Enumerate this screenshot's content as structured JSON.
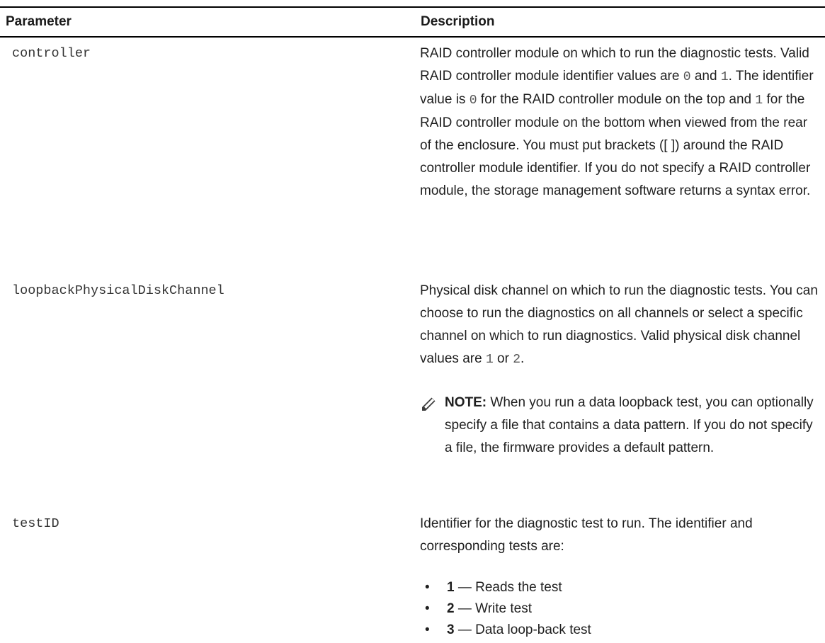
{
  "table": {
    "headers": {
      "parameter": "Parameter",
      "description": "Description"
    },
    "rows": [
      {
        "parameter": "controller",
        "description": {
          "p1": "RAID controller module on which to run the diagnostic tests. Valid RAID controller module identifier values are ",
          "c1": "0",
          "p2": " and ",
          "c2": "1",
          "p3": ". The identifier value is ",
          "c3": "0",
          "p4": " for the RAID controller module on the top and ",
          "c4": "1",
          "p5": " for the RAID controller module on the bottom when viewed from the rear of the enclosure. You must put brackets ([ ]) around the RAID controller module identifier. If you do not specify a RAID controller module, the storage management software returns a syntax error."
        }
      },
      {
        "parameter": "loopbackPhysicalDiskChannel",
        "description": {
          "p1": "Physical disk channel on which to run the diagnostic tests. You can choose to run the diagnostics on all channels or select a specific channel on which to run diagnostics. Valid physical disk channel values are ",
          "c1": "1",
          "p2": " or ",
          "c2": "2",
          "p3": "."
        },
        "note": {
          "icon": "note-pencil-icon",
          "label": "NOTE:",
          "text": " When you run a data loopback test, you can optionally specify a file that contains a data pattern. If you do not specify a file, the firmware provides a default pattern."
        }
      },
      {
        "parameter": "testID",
        "description": {
          "p1": "Identifier for the diagnostic test to run. The identifier and corresponding tests are:"
        },
        "list": [
          {
            "bullet": "•",
            "num": "1",
            "text": " — Reads the test"
          },
          {
            "bullet": "•",
            "num": "2",
            "text": " — Write test"
          },
          {
            "bullet": "•",
            "num": "3",
            "text": " — Data loop-back test"
          }
        ]
      }
    ]
  }
}
